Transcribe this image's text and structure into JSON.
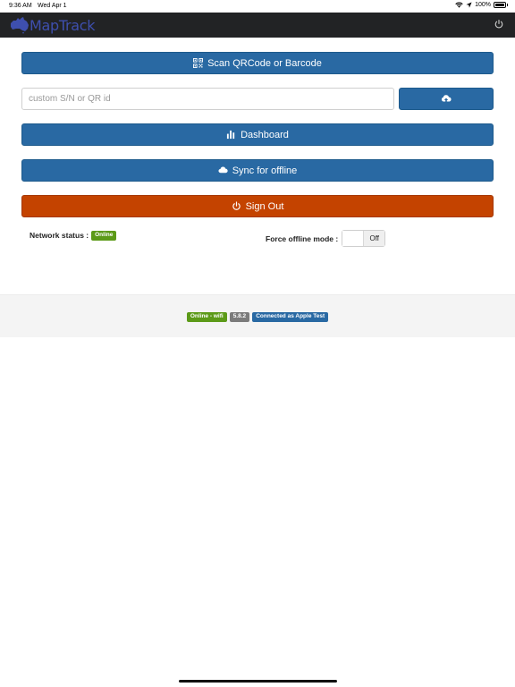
{
  "status_bar": {
    "time": "9:36 AM",
    "date": "Wed Apr 1",
    "battery": "100%"
  },
  "header": {
    "brand": "MapTrack",
    "brand_color": "#3e4fae"
  },
  "buttons": {
    "scan": "Scan QRCode or Barcode",
    "dashboard": "Dashboard",
    "sync": "Sync for offline",
    "signout": "Sign Out"
  },
  "serial_input": {
    "placeholder": "custom S/N or QR id",
    "value": ""
  },
  "network": {
    "label": "Network status :",
    "status": "Online"
  },
  "offline_mode": {
    "label": "Force offline mode :",
    "state": "Off"
  },
  "footer": {
    "connection": "Online - wifi",
    "version": "5.8.2",
    "user": "Connected as Apple Test"
  },
  "colors": {
    "primary": "#2969a3",
    "danger": "#c44300",
    "success": "#5c9a18",
    "header_bg": "#222325"
  }
}
